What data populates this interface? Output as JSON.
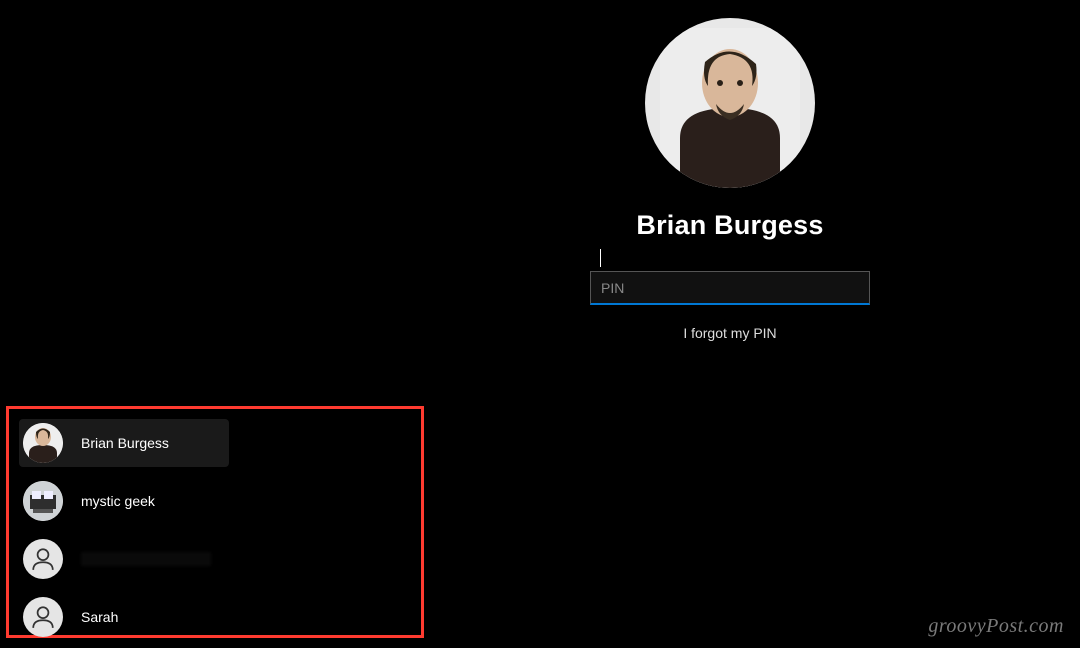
{
  "login": {
    "username": "Brian Burgess",
    "pin_placeholder": "PIN",
    "forgot_pin": "I forgot my PIN"
  },
  "userlist": [
    {
      "name": "Brian Burgess",
      "avatar_type": "portrait-brian",
      "selected": true
    },
    {
      "name": "mystic geek",
      "avatar_type": "photo-desk",
      "selected": false
    },
    {
      "name": "",
      "avatar_type": "generic",
      "selected": false,
      "redacted": true
    },
    {
      "name": "Sarah",
      "avatar_type": "generic",
      "selected": false
    }
  ],
  "watermark": "groovyPost.com",
  "colors": {
    "accent": "#0078d4",
    "highlight_box": "#ff3b30"
  }
}
